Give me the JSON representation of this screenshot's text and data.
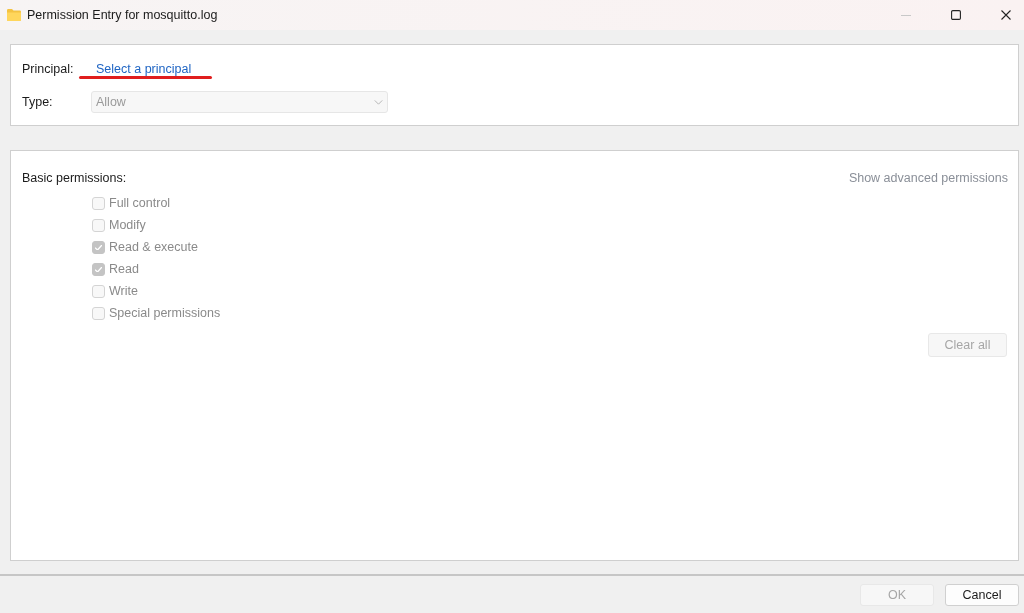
{
  "window": {
    "title": "Permission Entry for mosquitto.log",
    "minimize_disabled": true
  },
  "principal": {
    "label": "Principal:",
    "link": "Select a principal",
    "annotated": true
  },
  "type": {
    "label": "Type:",
    "value": "Allow",
    "disabled": true
  },
  "basic_permissions": {
    "label": "Basic permissions:",
    "advanced_link": {
      "label": "Show advanced permissions",
      "disabled": true
    },
    "permissions": [
      {
        "label": "Full control",
        "checked": false,
        "disabled": true
      },
      {
        "label": "Modify",
        "checked": false,
        "disabled": true
      },
      {
        "label": "Read & execute",
        "checked": true,
        "disabled": true
      },
      {
        "label": "Read",
        "checked": true,
        "disabled": true
      },
      {
        "label": "Write",
        "checked": false,
        "disabled": true
      },
      {
        "label": "Special permissions",
        "checked": false,
        "disabled": true
      }
    ],
    "clear_all": {
      "label": "Clear all",
      "disabled": true
    }
  },
  "buttons": [
    {
      "label": "OK",
      "disabled": true
    },
    {
      "label": "Cancel",
      "disabled": false
    }
  ]
}
